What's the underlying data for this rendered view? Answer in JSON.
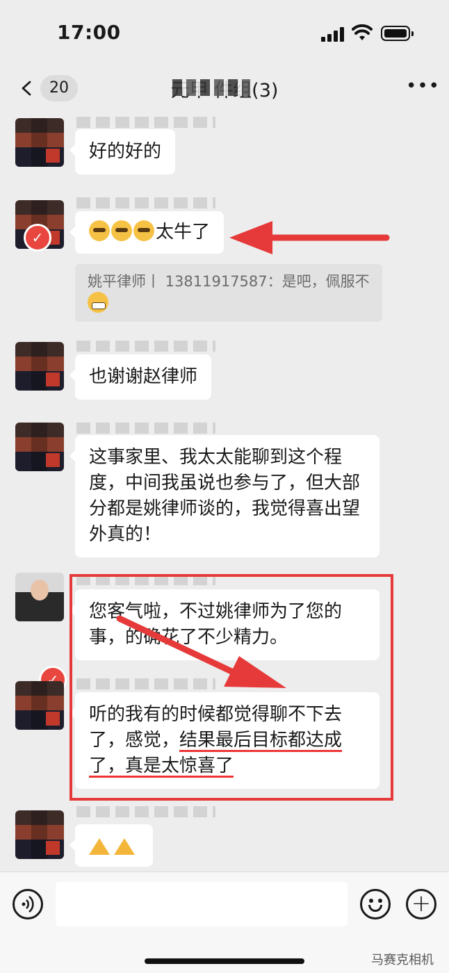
{
  "status": {
    "time": "17:00"
  },
  "nav": {
    "unread_count": "20",
    "title": "元甲   件组(3)"
  },
  "messages": {
    "m1": "好的好的",
    "m2": "太牛了",
    "m2_quote": "姚平律师丨 13811917587：是吧，佩服不",
    "m3": "也谢谢赵律师",
    "m4": "这事家里、我太太能聊到这个程度，中间我虽说也参与了，但大部分都是姚律师谈的，我觉得喜出望外真的！",
    "m5": "您客气啦，不过姚律师为了您的事，的确花了不少精力。",
    "m6_a": "听的我有的时候都觉得聊不下去了，感觉，",
    "m6_b": "结果最后目标都达成了，真是太惊喜了"
  },
  "annotations": {
    "accent": "#e63a3a"
  },
  "footer": {
    "watermark": "马赛克相机"
  }
}
